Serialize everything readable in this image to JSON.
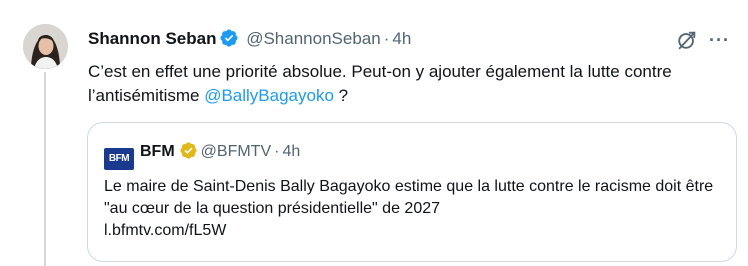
{
  "tweet": {
    "author_name": "Shannon Seban",
    "handle": "@ShannonSeban",
    "separator": "·",
    "time": "4h",
    "more_label": "···",
    "body_text": "C’est en effet une priorité absolue. Peut-on y ajouter également la lutte contre l’antisémitisme ",
    "mention": "@BallyBagayoko",
    "body_end": " ?"
  },
  "quote": {
    "logo_text": "BFM",
    "author_name": "BFM",
    "handle": "@BFMTV",
    "separator": "·",
    "time": "4h",
    "text": "Le maire de Saint-Denis Bally Bagayoko estime que la lutte contre le racisme doit être \"au cœur de la question présidentielle\" de 2027",
    "link": "l.bfmtv.com/fL5W"
  },
  "colors": {
    "verified_blue": "#1d9bf0",
    "verified_gold": "#e2b719",
    "mention_blue": "#1d9bf0",
    "secondary_text": "#536471",
    "border": "#cfd9de",
    "bfm_blue": "#1a3a8f"
  },
  "icons": {
    "avatar": "avatar",
    "verified": "verified-badge-icon",
    "gold_verified": "gold-verified-badge-icon",
    "grok": "grok-icon",
    "more": "more-options-icon"
  }
}
